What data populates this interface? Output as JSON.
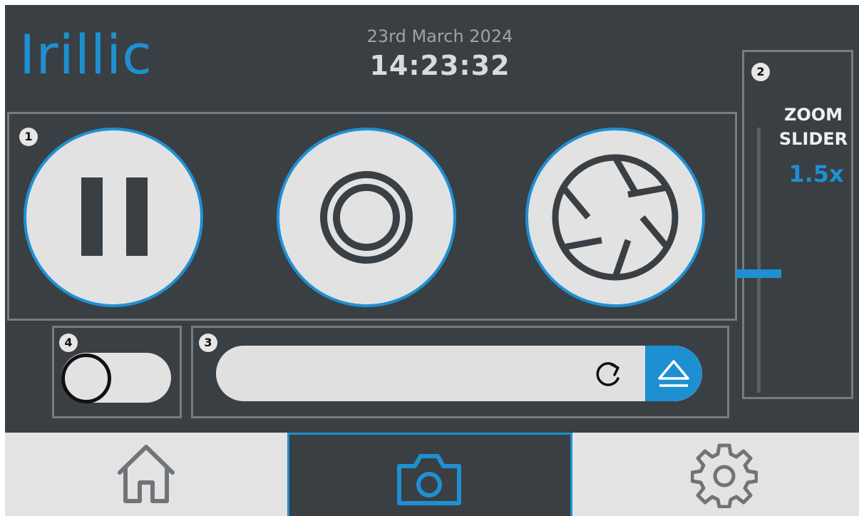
{
  "header": {
    "logo_text": "Irillic",
    "date": "23rd March 2024",
    "time": "14:23:32"
  },
  "panels": {
    "controls_badge": "1",
    "zoom_badge": "2",
    "url_badge": "3",
    "toggle_badge": "4"
  },
  "controls": {
    "pause_icon": "pause-icon",
    "record_icon": "record-icon",
    "capture_icon": "aperture-icon"
  },
  "zoom": {
    "label_line1": "ZOOM",
    "label_line2": "SLIDER",
    "value": "1.5x",
    "level_fraction": 0.45
  },
  "toggle": {
    "state": "off"
  },
  "url_bar": {
    "value": "",
    "reload_icon": "reload-icon",
    "eject_icon": "eject-icon"
  },
  "nav": {
    "tabs": [
      {
        "name": "home",
        "icon": "home-icon",
        "active": false
      },
      {
        "name": "camera",
        "icon": "camera-icon",
        "active": true
      },
      {
        "name": "settings",
        "icon": "gear-icon",
        "active": false
      }
    ]
  },
  "colors": {
    "accent": "#1e90d2",
    "background": "#3a3f44",
    "button_fill": "#e2e2e2"
  }
}
